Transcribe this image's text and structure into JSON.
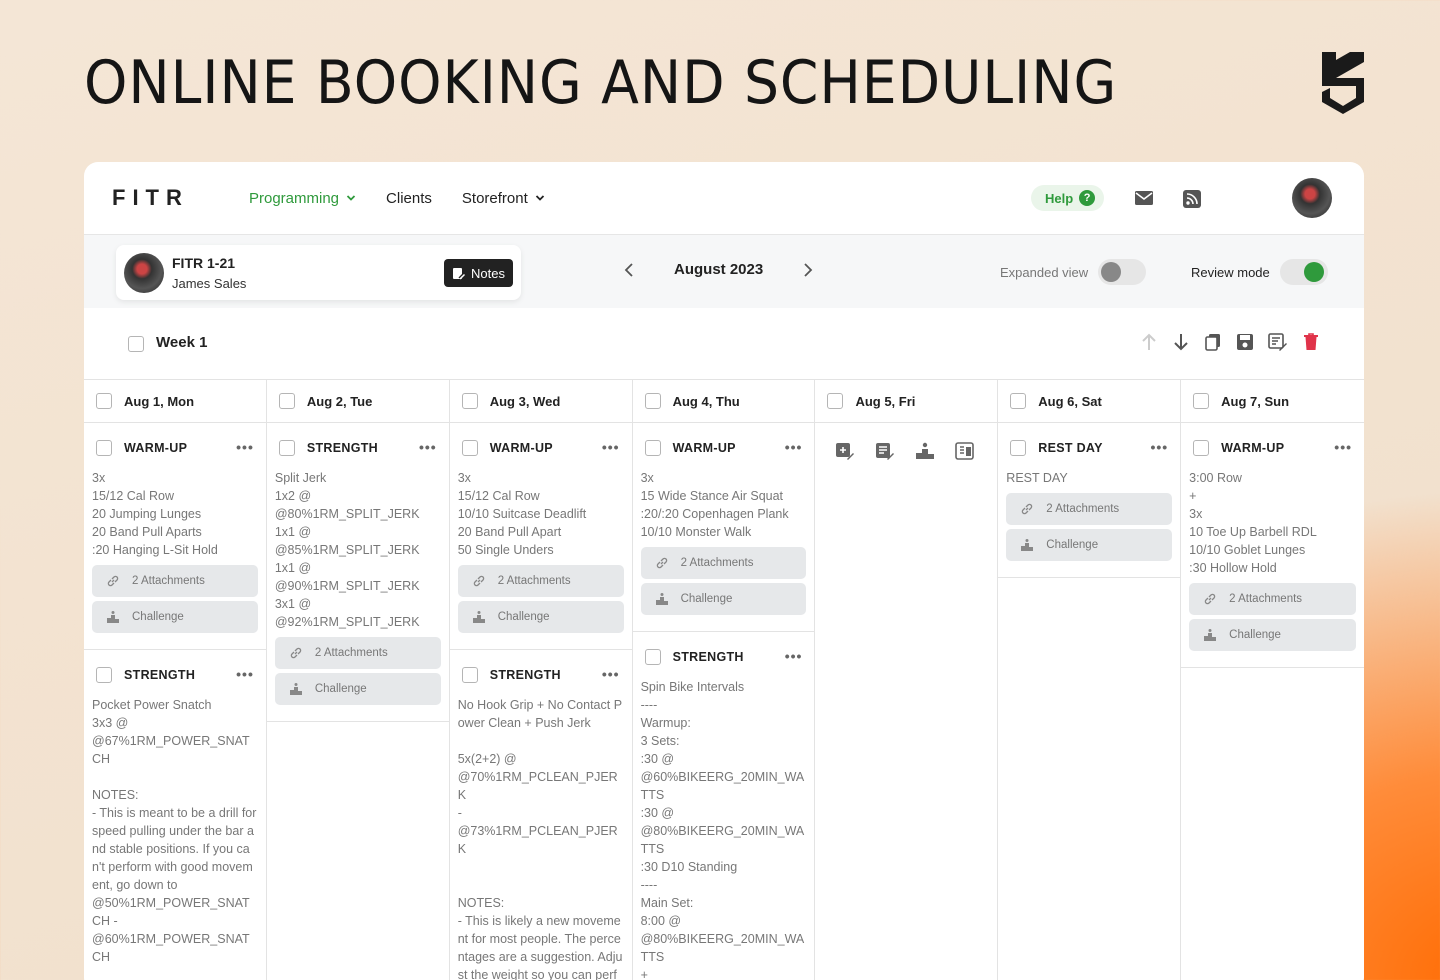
{
  "hero": {
    "title": "ONLINE BOOKING AND SCHEDULING"
  },
  "topbar": {
    "logo": "FITR",
    "nav": [
      {
        "label": "Programming",
        "active": true,
        "dropdown": true
      },
      {
        "label": "Clients",
        "active": false,
        "dropdown": false
      },
      {
        "label": "Storefront",
        "active": false,
        "dropdown": true
      }
    ],
    "help_label": "Help",
    "help_badge": "?",
    "accent_color": "#2f9a3c"
  },
  "client": {
    "name": "FITR 1-21",
    "subtitle": "James Sales",
    "notes_label": "Notes"
  },
  "calendar": {
    "month": "August 2023",
    "expanded_view_label": "Expanded view",
    "expanded_view_on": false,
    "review_mode_label": "Review mode",
    "review_mode_on": true
  },
  "week": {
    "label": "Week 1"
  },
  "days": [
    {
      "label": "Aug 1, Mon",
      "blocks": [
        {
          "title": "WARM-UP",
          "text": "3x\n15/12 Cal Row\n20 Jumping Lunges\n20 Band Pull Aparts\n:20 Hanging L-Sit Hold",
          "attachments": "2 Attachments",
          "challenge": "Challenge"
        },
        {
          "title": "STRENGTH",
          "text": "Pocket Power Snatch\n3x3 @\n@67%1RM_POWER_SNATCH\n\nNOTES:\n- This is meant to be a drill for speed pulling under the bar and stable positions. If you can't perform with good movement, go down to\n@50%1RM_POWER_SNATCH -\n@60%1RM_POWER_SNATCH"
        }
      ]
    },
    {
      "label": "Aug 2, Tue",
      "blocks": [
        {
          "title": "STRENGTH",
          "text": "Split Jerk\n1x2 @\n@80%1RM_SPLIT_JERK\n1x1 @\n@85%1RM_SPLIT_JERK\n1x1 @\n@90%1RM_SPLIT_JERK\n3x1 @\n@92%1RM_SPLIT_JERK",
          "attachments": "2 Attachments",
          "challenge": "Challenge"
        }
      ]
    },
    {
      "label": "Aug 3, Wed",
      "blocks": [
        {
          "title": "WARM-UP",
          "text": "3x\n15/12 Cal Row\n10/10 Suitcase Deadlift\n20 Band Pull Apart\n50 Single Unders",
          "attachments": "2 Attachments",
          "challenge": "Challenge"
        },
        {
          "title": "STRENGTH",
          "text": "No Hook Grip + No Contact Power Clean + Push Jerk\n\n5x(2+2) @\n@70%1RM_PCLEAN_PJERK\n-\n@73%1RM_PCLEAN_PJERK\n\n\nNOTES:\n- This is likely a new movement for most people. The percentages are a suggestion. Adjust the weight so you can perform the movement"
        }
      ]
    },
    {
      "label": "Aug 4, Thu",
      "blocks": [
        {
          "title": "WARM-UP",
          "text": "3x\n15 Wide Stance Air Squat\n:20/:20 Copenhagen Plank\n10/10 Monster Walk",
          "attachments": "2 Attachments",
          "challenge": "Challenge"
        },
        {
          "title": "STRENGTH",
          "text": "Spin Bike Intervals\n----\nWarmup:\n3 Sets:\n:30 @\n@60%BIKEERG_20MIN_WATTS\n:30 @\n@80%BIKEERG_20MIN_WATTS\n:30 D10 Standing\n----\nMain Set:\n8:00 @\n@80%BIKEERG_20MIN_WATTS\n+"
        }
      ]
    },
    {
      "label": "Aug 5, Fri",
      "blocks": []
    },
    {
      "label": "Aug 6, Sat",
      "blocks": [
        {
          "title": "REST DAY",
          "text": "REST DAY",
          "attachments": "2 Attachments",
          "challenge": "Challenge"
        }
      ]
    },
    {
      "label": "Aug 7, Sun",
      "blocks": [
        {
          "title": "WARM-UP",
          "text": "3:00 Row\n+\n3x\n10 Toe Up Barbell RDL\n10/10 Goblet Lunges\n:30 Hollow Hold",
          "attachments": "2 Attachments",
          "challenge": "Challenge"
        }
      ]
    }
  ]
}
